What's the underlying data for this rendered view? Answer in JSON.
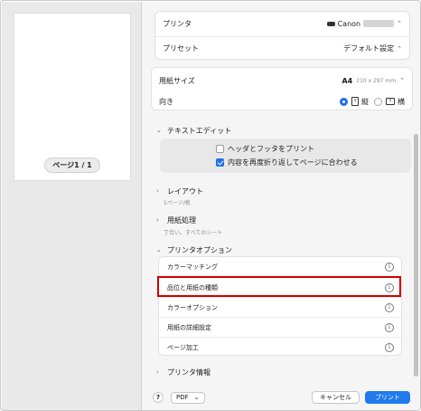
{
  "preview": {
    "page_indicator": "ページ1 / 1"
  },
  "top": {
    "printer_label": "プリンタ",
    "printer_value": "Canon",
    "preset_label": "プリセット",
    "preset_value": "デフォルト設定"
  },
  "paper": {
    "size_label": "用紙サイズ",
    "size_value": "A4",
    "size_dims": "210 x 297 mm",
    "orientation_label": "向き",
    "portrait_label": "縦",
    "landscape_label": "横",
    "portrait_selected": true
  },
  "textedit": {
    "heading": "テキストエディット",
    "opt1": "ヘッダとフッタをプリント",
    "opt1_checked": false,
    "opt2": "内容を再度折り返してページに合わせる",
    "opt2_checked": true
  },
  "layout": {
    "heading": "レイアウト",
    "sub": "1ページ/枚"
  },
  "paper_handling": {
    "heading": "用紙処理",
    "sub": "丁合い、すべてのシート"
  },
  "printer_options": {
    "heading": "プリンタオプション",
    "items": [
      {
        "label": "カラーマッチング"
      },
      {
        "label": "品位と用紙の種類"
      },
      {
        "label": "カラーオプション"
      },
      {
        "label": "用紙の詳細設定"
      },
      {
        "label": "ページ加工"
      }
    ]
  },
  "printer_info": {
    "heading": "プリンタ情報"
  },
  "bottom": {
    "help": "?",
    "pdf": "PDF",
    "cancel": "キャンセル",
    "print": "プリント"
  },
  "colors": {
    "accent": "#1f7aec",
    "highlight": "#d40000"
  }
}
